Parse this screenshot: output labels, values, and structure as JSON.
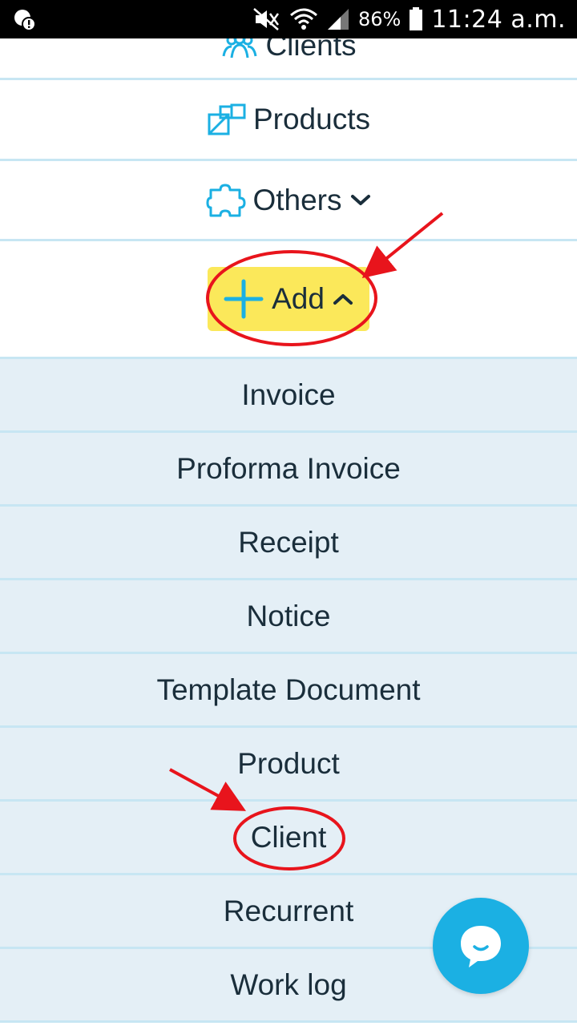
{
  "status_bar": {
    "battery_percent": "86%",
    "time": "11:24 a.m.",
    "icons": [
      "notification-alert-icon",
      "mute-icon",
      "wifi-icon",
      "signal-icon",
      "battery-icon"
    ]
  },
  "menu": {
    "clients_label": "Clients",
    "products_label": "Products",
    "others_label": "Others",
    "add_label": "Add",
    "add_items": [
      "Invoice",
      "Proforma Invoice",
      "Receipt",
      "Notice",
      "Template Document",
      "Product",
      "Client",
      "Recurrent",
      "Work log"
    ]
  },
  "colors": {
    "accent": "#1bb0e3",
    "highlight": "#fbe85a",
    "annotation": "#e8141c",
    "submenu_bg": "#e4eff6",
    "divider": "#c7e6f3"
  }
}
